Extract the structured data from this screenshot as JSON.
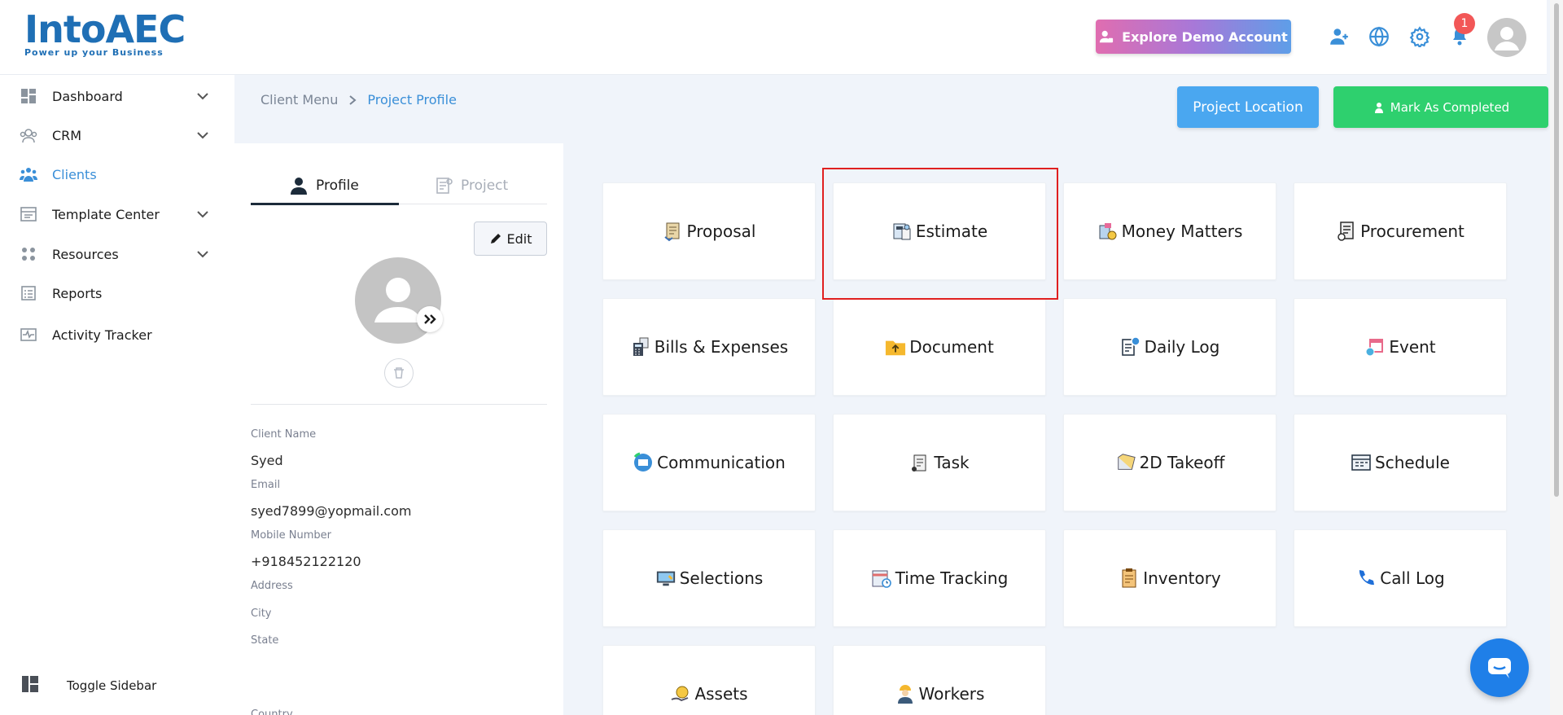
{
  "header": {
    "logo_main": "IntoAEC",
    "logo_tagline": "Power up your Business",
    "demo_button": "Explore Demo Account",
    "notification_count": "1"
  },
  "sidebar": {
    "items": [
      {
        "label": "Dashboard",
        "icon": "dashboard-icon",
        "has_chevron": true
      },
      {
        "label": "CRM",
        "icon": "crm-icon",
        "has_chevron": true
      },
      {
        "label": "Clients",
        "icon": "clients-icon",
        "has_chevron": false,
        "active": true
      },
      {
        "label": "Template Center",
        "icon": "template-icon",
        "has_chevron": true
      },
      {
        "label": "Resources",
        "icon": "resources-icon",
        "has_chevron": true
      },
      {
        "label": "Reports",
        "icon": "reports-icon",
        "has_chevron": false
      },
      {
        "label": "Activity Tracker",
        "icon": "activity-icon",
        "has_chevron": false
      }
    ],
    "toggle_label": "Toggle Sidebar"
  },
  "breadcrumb": {
    "parent": "Client Menu",
    "current": "Project Profile"
  },
  "actions": {
    "project_location": "Project Location",
    "mark_completed": "Mark As Completed"
  },
  "profile": {
    "tabs": [
      "Profile",
      "Project"
    ],
    "edit_label": "Edit",
    "fields": [
      {
        "label": "Client Name",
        "value": "Syed"
      },
      {
        "label": "Email",
        "value": "syed7899@yopmail.com"
      },
      {
        "label": "Mobile Number",
        "value": "+918452122120"
      },
      {
        "label": "Address",
        "value": ""
      },
      {
        "label": "City",
        "value": ""
      },
      {
        "label": "State",
        "value": ""
      },
      {
        "label": "Country",
        "value": ""
      }
    ]
  },
  "modules": [
    {
      "label": "Proposal",
      "icon": "proposal-icon"
    },
    {
      "label": "Estimate",
      "icon": "estimate-icon"
    },
    {
      "label": "Money Matters",
      "icon": "money-matters-icon"
    },
    {
      "label": "Procurement",
      "icon": "procurement-icon"
    },
    {
      "label": "Bills & Expenses",
      "icon": "calculator-icon"
    },
    {
      "label": "Document",
      "icon": "folder-upload-icon"
    },
    {
      "label": "Daily Log",
      "icon": "daily-log-icon"
    },
    {
      "label": "Event",
      "icon": "calendar-icon"
    },
    {
      "label": "Communication",
      "icon": "communication-icon"
    },
    {
      "label": "Task",
      "icon": "task-icon"
    },
    {
      "label": "2D Takeoff",
      "icon": "takeoff-icon"
    },
    {
      "label": "Schedule",
      "icon": "schedule-icon"
    },
    {
      "label": "Selections",
      "icon": "selections-icon"
    },
    {
      "label": "Time Tracking",
      "icon": "time-tracking-icon"
    },
    {
      "label": "Inventory",
      "icon": "inventory-icon"
    },
    {
      "label": "Call Log",
      "icon": "phone-icon"
    },
    {
      "label": "Assets",
      "icon": "assets-icon"
    },
    {
      "label": "Workers",
      "icon": "worker-icon"
    }
  ],
  "colors": {
    "accent": "#3a8fd8",
    "location_button": "#4aa7f0",
    "completed_button": "#2ed06e",
    "highlight": "#e02020"
  }
}
